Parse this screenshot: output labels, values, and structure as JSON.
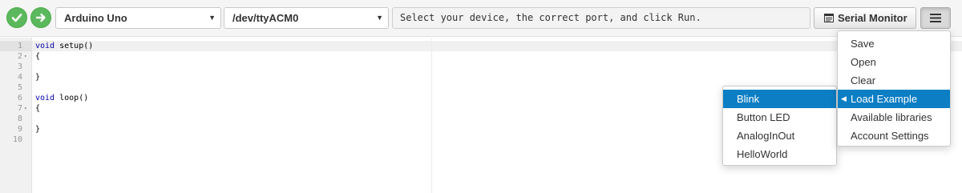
{
  "toolbar": {
    "verify_button": {
      "icon": "check-icon",
      "color": "#5cb85c"
    },
    "upload_button": {
      "icon": "arrow-right-icon",
      "color": "#5cb85c"
    },
    "board_select": {
      "value": "Arduino Uno"
    },
    "port_select": {
      "value": "/dev/ttyACM0"
    },
    "status_message": "Select your device, the correct port, and click Run.",
    "serial_monitor_label": "Serial Monitor",
    "menu_button": {
      "icon": "hamburger-icon"
    }
  },
  "editor": {
    "lines": [
      {
        "n": "1",
        "text": " setup()",
        "kw": "void",
        "fold": ""
      },
      {
        "n": "2",
        "text": "{",
        "kw": "",
        "fold": "▾"
      },
      {
        "n": "3",
        "text": "",
        "kw": "",
        "fold": ""
      },
      {
        "n": "4",
        "text": "}",
        "kw": "",
        "fold": ""
      },
      {
        "n": "5",
        "text": "",
        "kw": "",
        "fold": ""
      },
      {
        "n": "6",
        "text": " loop()",
        "kw": "void",
        "fold": ""
      },
      {
        "n": "7",
        "text": "{",
        "kw": "",
        "fold": "▾"
      },
      {
        "n": "8",
        "text": "",
        "kw": "",
        "fold": ""
      },
      {
        "n": "9",
        "text": "}",
        "kw": "",
        "fold": ""
      },
      {
        "n": "10",
        "text": "",
        "kw": "",
        "fold": ""
      }
    ]
  },
  "dropdown_menu": {
    "items": [
      {
        "label": "Save",
        "active": false
      },
      {
        "label": "Open",
        "active": false
      },
      {
        "label": "Clear",
        "active": false
      },
      {
        "label": "Load Example",
        "active": true
      },
      {
        "label": "Available libraries",
        "active": false
      },
      {
        "label": "Account Settings",
        "active": false
      }
    ]
  },
  "examples_submenu": {
    "items": [
      {
        "label": "Blink",
        "active": true
      },
      {
        "label": "Button LED",
        "active": false
      },
      {
        "label": "AnalogInOut",
        "active": false
      },
      {
        "label": "HelloWorld",
        "active": false
      }
    ]
  },
  "colors": {
    "accent": "#0b7ec4",
    "success": "#5cb85c",
    "keyword": "#0000a2"
  }
}
